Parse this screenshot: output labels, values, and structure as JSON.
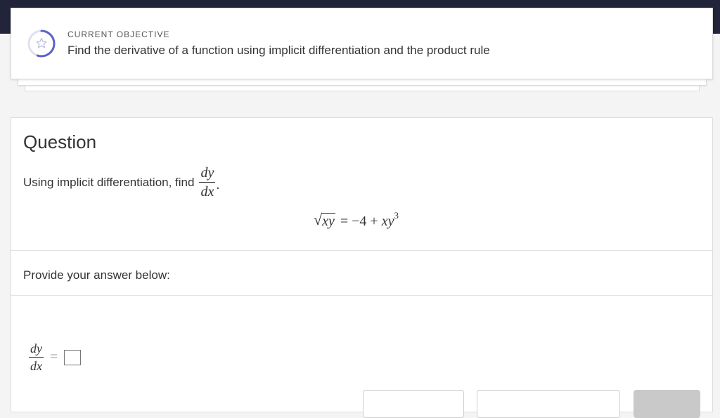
{
  "objective": {
    "label": "CURRENT OBJECTIVE",
    "text": "Find the derivative of a function using implicit differentiation and the product rule",
    "icon": "star-icon",
    "progress": 0.55,
    "accent": "#5b63c9"
  },
  "question": {
    "title": "Question",
    "prompt": "Using implicit differentiation, find",
    "frac_num": "dy",
    "frac_den": "dx",
    "period": ".",
    "equation": {
      "radicand": "xy",
      "rhs_prefix": "= −4 +",
      "rhs_var": "xy",
      "exponent": "3"
    }
  },
  "answer": {
    "label": "Provide your answer below:",
    "frac_num": "dy",
    "frac_den": "dx",
    "equals": "="
  },
  "buttons": {
    "a_label": "",
    "b_label": "",
    "c_label": ""
  },
  "colors": {
    "topbar": "#22253a",
    "submit_disabled": "#c9c9c9"
  }
}
